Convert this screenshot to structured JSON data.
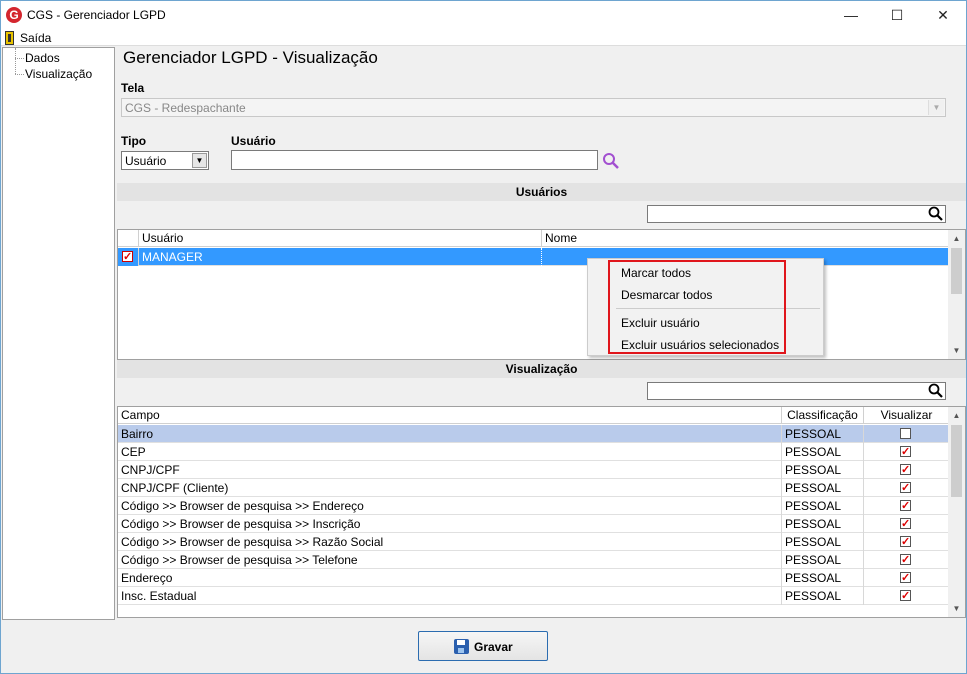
{
  "window": {
    "title": "CGS - Gerenciador LGPD",
    "app_icon": "G"
  },
  "menu": {
    "exit_label": "Saída"
  },
  "tree": {
    "items": [
      "Dados",
      "Visualização"
    ]
  },
  "main": {
    "title": "Gerenciador LGPD - Visualização",
    "tela_label": "Tela",
    "tela_value": "CGS - Redespachante",
    "tipo_label": "Tipo",
    "tipo_value": "Usuário",
    "usuario_label": "Usuário",
    "usuario_value": ""
  },
  "users_section": {
    "title": "Usuários",
    "filter_value": "",
    "columns": [
      "Usuário",
      "Nome"
    ],
    "rows": [
      {
        "usuario": "MANAGER",
        "nome": "",
        "checked": true
      }
    ]
  },
  "context_menu": {
    "items": [
      "Marcar todos",
      "Desmarcar todos",
      "Excluir usuário",
      "Excluir usuários selecionados"
    ]
  },
  "view_section": {
    "title": "Visualização",
    "filter_value": "",
    "columns": [
      "Campo",
      "Classificação",
      "Visualizar"
    ],
    "rows": [
      {
        "campo": "Bairro",
        "classificacao": "PESSOAL",
        "visualizar": false
      },
      {
        "campo": "CEP",
        "classificacao": "PESSOAL",
        "visualizar": true
      },
      {
        "campo": "CNPJ/CPF",
        "classificacao": "PESSOAL",
        "visualizar": true
      },
      {
        "campo": "CNPJ/CPF (Cliente)",
        "classificacao": "PESSOAL",
        "visualizar": true
      },
      {
        "campo": "Código >> Browser de pesquisa >> Endereço",
        "classificacao": "PESSOAL",
        "visualizar": true
      },
      {
        "campo": "Código >> Browser de pesquisa >> Inscrição",
        "classificacao": "PESSOAL",
        "visualizar": true
      },
      {
        "campo": "Código >> Browser de pesquisa >> Razão Social",
        "classificacao": "PESSOAL",
        "visualizar": true
      },
      {
        "campo": "Código >> Browser de pesquisa >> Telefone",
        "classificacao": "PESSOAL",
        "visualizar": true
      },
      {
        "campo": "Endereço",
        "classificacao": "PESSOAL",
        "visualizar": true
      },
      {
        "campo": "Insc. Estadual",
        "classificacao": "PESSOAL",
        "visualizar": true
      }
    ]
  },
  "footer": {
    "save_label": "Gravar"
  },
  "colors": {
    "selection": "#3399ff",
    "highlight_border": "#e0161c",
    "row_selected_view": "#b9cbeb"
  }
}
